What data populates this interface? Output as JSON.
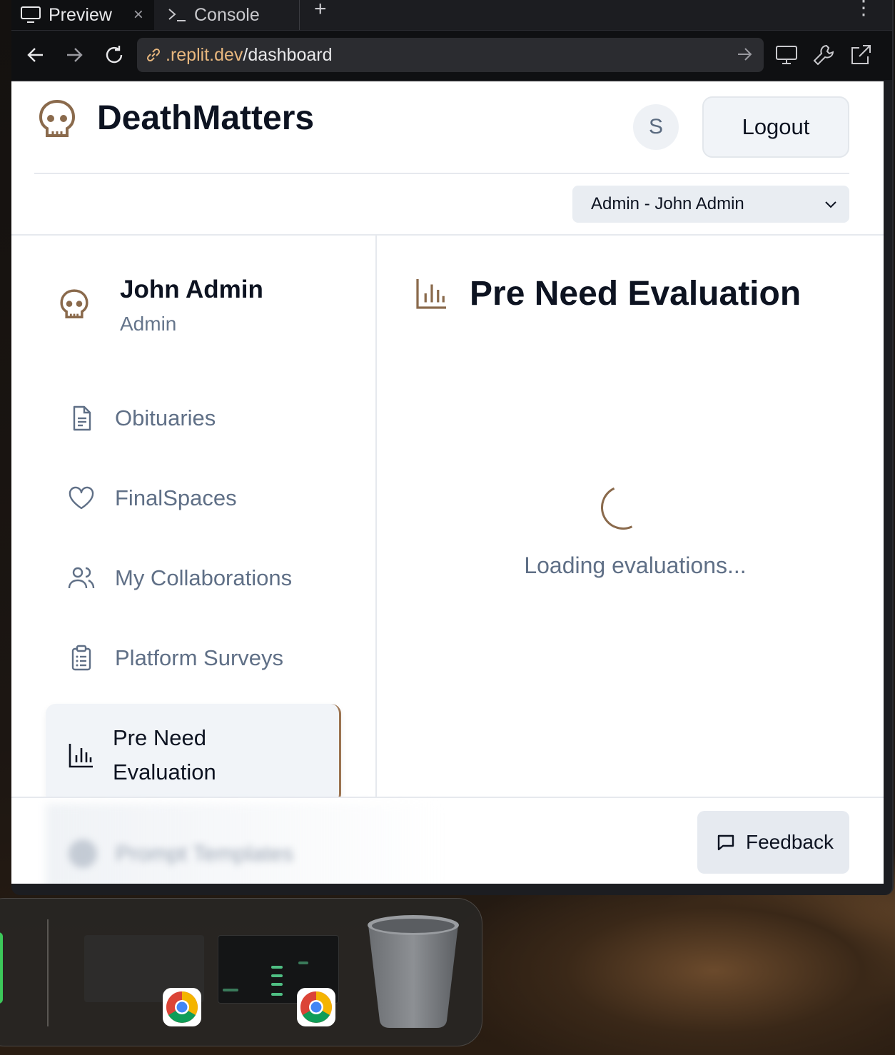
{
  "browser": {
    "tabs": [
      {
        "label": "Preview",
        "icon": "monitor-icon",
        "active": true
      },
      {
        "label": "Console",
        "icon": "terminal-icon",
        "active": false
      }
    ],
    "url_host": ".replit.dev",
    "url_path": "/dashboard"
  },
  "app": {
    "title": "DeathMatters",
    "avatar_initial": "S",
    "logout_label": "Logout",
    "role_select_value": "Admin - John Admin"
  },
  "sidebar": {
    "user_name": "John Admin",
    "user_role": "Admin",
    "items": [
      {
        "label": "Obituaries",
        "icon": "document-icon"
      },
      {
        "label": "FinalSpaces",
        "icon": "heart-icon"
      },
      {
        "label": "My Collaborations",
        "icon": "users-icon"
      },
      {
        "label": "Platform Surveys",
        "icon": "clipboard-icon"
      },
      {
        "label": "Pre Need Evaluation",
        "icon": "bar-chart-icon",
        "active": true
      },
      {
        "label": "Prompt Templates",
        "icon": "template-icon"
      }
    ]
  },
  "main": {
    "title": "Pre Need Evaluation",
    "loading_text": "Loading evaluations..."
  },
  "footer": {
    "feedback_label": "Feedback"
  },
  "colors": {
    "accent": "#9b7350",
    "text_dark": "#0d1321",
    "text_muted": "#5f6f86"
  }
}
